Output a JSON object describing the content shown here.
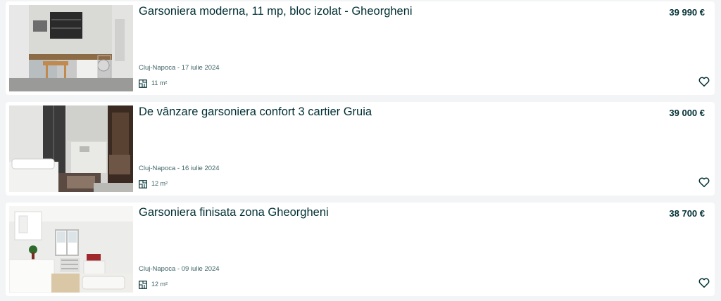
{
  "listings": [
    {
      "title": "Garsoniera moderna, 11 mp, bloc izolat - Gheorgheni",
      "price": "39 990 €",
      "location_date": "Cluj-Napoca - 17 iulie 2024",
      "area": "11 m²",
      "image_icon": "apartment-photo"
    },
    {
      "title": "De vânzare garsoniera confort 3 cartier Gruia",
      "price": "39 000 €",
      "location_date": "Cluj-Napoca - 16 iulie 2024",
      "area": "12 m²",
      "image_icon": "apartment-photo"
    },
    {
      "title": "Garsoniera finisata zona Gheorgheni",
      "price": "38 700 €",
      "location_date": "Cluj-Napoca - 09 iulie 2024",
      "area": "12 m²",
      "image_icon": "apartment-photo"
    }
  ],
  "icons": {
    "area": "floor-plan-icon",
    "favorite": "heart-outline-icon"
  },
  "colors": {
    "text": "#002f34",
    "muted": "#406367",
    "background": "#f2f4f5",
    "card": "#ffffff"
  }
}
